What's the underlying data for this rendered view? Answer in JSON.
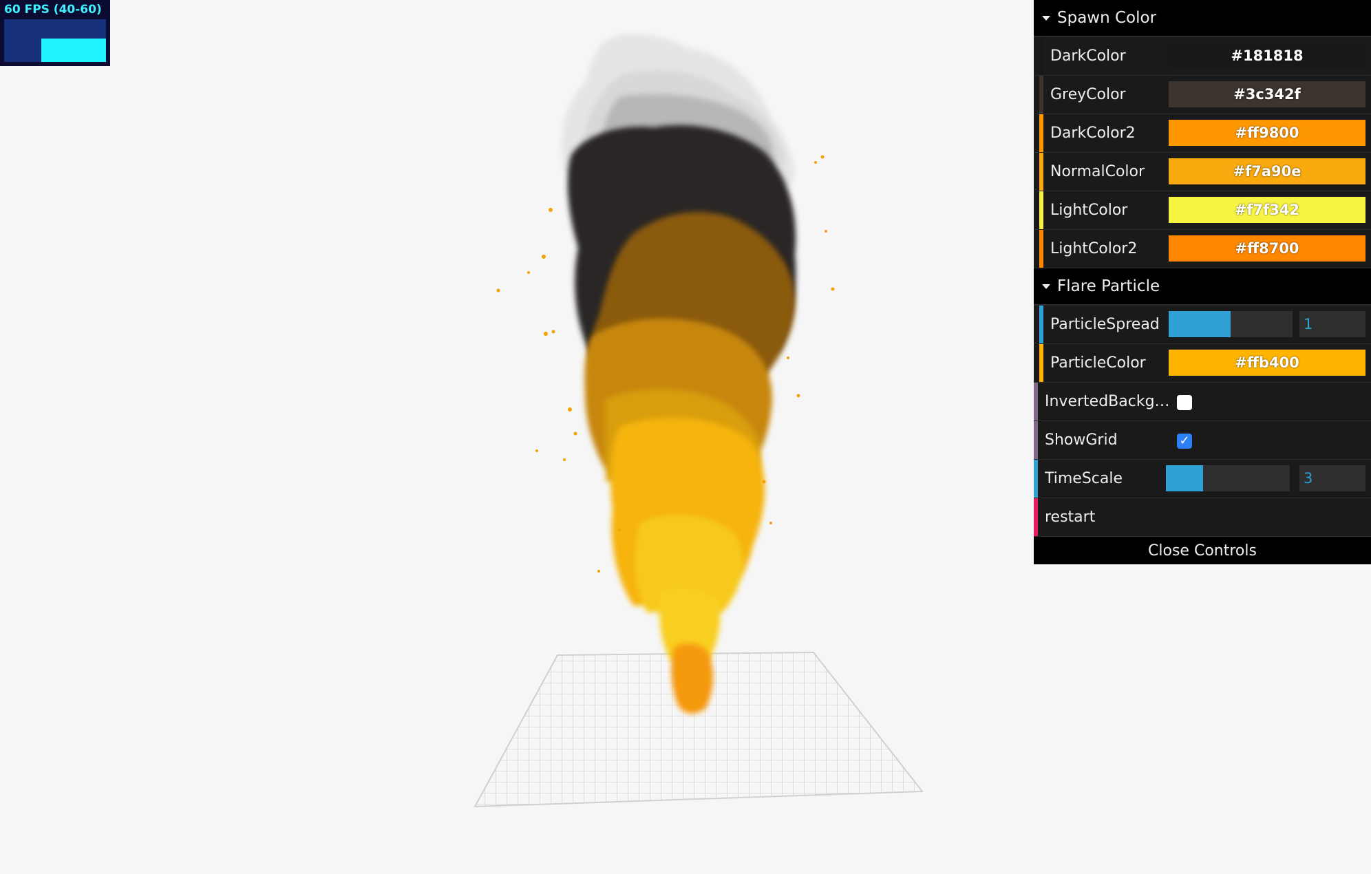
{
  "stats": {
    "fps_label": "60 FPS (40-60)"
  },
  "gui": {
    "folders": [
      {
        "title": "Spawn Color",
        "rows": [
          {
            "label": "DarkColor",
            "value": "#181818",
            "color": "#181818",
            "accent": "#181818"
          },
          {
            "label": "GreyColor",
            "value": "#3c342f",
            "color": "#3c342f",
            "accent": "#3c342f"
          },
          {
            "label": "DarkColor2",
            "value": "#ff9800",
            "color": "#ff9800",
            "accent": "#ff9800"
          },
          {
            "label": "NormalColor",
            "value": "#f7a90e",
            "color": "#f7a90e",
            "accent": "#f7a90e"
          },
          {
            "label": "LightColor",
            "value": "#f7f342",
            "color": "#f7f342",
            "accent": "#f7f342"
          },
          {
            "label": "LightColor2",
            "value": "#ff8700",
            "color": "#ff8700",
            "accent": "#ff8700"
          }
        ]
      },
      {
        "title": "Flare Particle",
        "spread": {
          "label": "ParticleSpread",
          "value": "1",
          "fraction": 0.5
        },
        "color": {
          "label": "ParticleColor",
          "value": "#ffb400",
          "color": "#ffb400"
        }
      }
    ],
    "inverted": {
      "label": "InvertedBackgr…",
      "checked": false
    },
    "showgrid": {
      "label": "ShowGrid",
      "checked": true
    },
    "timescale": {
      "label": "TimeScale",
      "value": "3",
      "fraction": 0.3
    },
    "restart": {
      "label": "restart"
    },
    "close": {
      "label": "Close Controls"
    }
  },
  "colors": {
    "slider": "#2fa1d6",
    "number_bar": "#2fa1d6",
    "boolean_bar": "#806787",
    "function_bar": "#e61d5f"
  }
}
